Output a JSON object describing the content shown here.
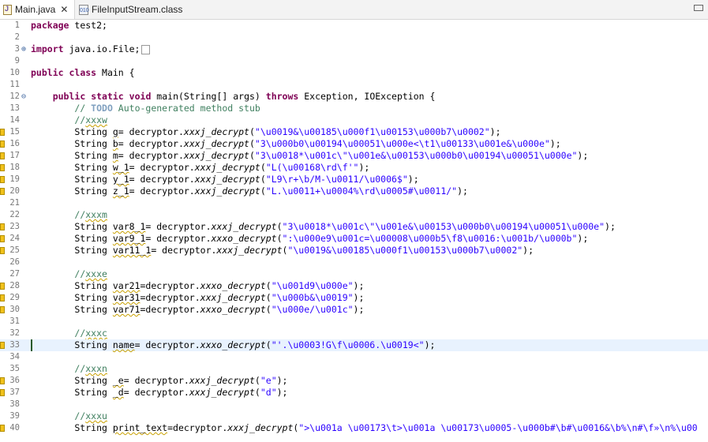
{
  "tabs": [
    {
      "label": "Main.java",
      "icon": "java-file-icon",
      "active": true
    },
    {
      "label": "FileInputStream.class",
      "icon": "class-file-icon",
      "active": false
    }
  ],
  "lines": [
    {
      "n": "1",
      "text": "package test2;"
    },
    {
      "n": "2",
      "text": ""
    },
    {
      "n": "3",
      "text": "import java.io.File;"
    },
    {
      "n": "9",
      "text": ""
    },
    {
      "n": "10",
      "text": "public class Main {"
    },
    {
      "n": "11",
      "text": ""
    },
    {
      "n": "12",
      "text": "    public static void main(String[] args) throws Exception, IOException {"
    },
    {
      "n": "13",
      "text": "        // TODO Auto-generated method stub"
    },
    {
      "n": "14",
      "text": "        //xxxw"
    },
    {
      "n": "15",
      "text": "        String g= decryptor.xxxj_decrypt(\"\\u0019&\\u00185\\u000f1\\u00153\\u000b7\\u0002\");"
    },
    {
      "n": "16",
      "text": "        String b= decryptor.xxxj_decrypt(\"3\\u000b0\\u00194\\u00051\\u000e<\\t1\\u00133\\u001e&\\u000e\");"
    },
    {
      "n": "17",
      "text": "        String m= decryptor.xxxj_decrypt(\"3\\u0018*\\u001c\\\"\\u001e&\\u00153\\u000b0\\u00194\\u00051\\u000e\");"
    },
    {
      "n": "18",
      "text": "        String w_1= decryptor.xxxj_decrypt(\"L(\\u00168\\rd\\f'\");"
    },
    {
      "n": "19",
      "text": "        String y_1= decryptor.xxxj_decrypt(\"L9\\r+\\b/M-\\u0011/\\u0006$\");"
    },
    {
      "n": "20",
      "text": "        String z_1= decryptor.xxxj_decrypt(\"L.\\u0011+\\u0004%\\rd\\u0005#\\u0011/\");"
    },
    {
      "n": "21",
      "text": ""
    },
    {
      "n": "22",
      "text": "        //xxxm"
    },
    {
      "n": "23",
      "text": "        String var8_1= decryptor.xxxj_decrypt(\"3\\u0018*\\u001c\\\"\\u001e&\\u00153\\u000b0\\u00194\\u00051\\u000e\");"
    },
    {
      "n": "24",
      "text": "        String var9_1= decryptor.xxxo_decrypt(\":\\u000e9\\u001c=\\u00008\\u000b5\\f8\\u0016:\\u001b/\\u000b\");"
    },
    {
      "n": "25",
      "text": "        String var11_1= decryptor.xxxj_decrypt(\"\\u0019&\\u00185\\u000f1\\u00153\\u000b7\\u0002\");"
    },
    {
      "n": "26",
      "text": ""
    },
    {
      "n": "27",
      "text": "        //xxxe"
    },
    {
      "n": "28",
      "text": "        String var21=decryptor.xxxo_decrypt(\"\\u001d9\\u000e\");"
    },
    {
      "n": "29",
      "text": "        String var31=decryptor.xxxj_decrypt(\"\\u000b&\\u0019\");"
    },
    {
      "n": "30",
      "text": "        String var71=decryptor.xxxo_decrypt(\"\\u000e/\\u001c\");"
    },
    {
      "n": "31",
      "text": ""
    },
    {
      "n": "32",
      "text": "        //xxxc"
    },
    {
      "n": "33",
      "text": "        String name= decryptor.xxxo_decrypt(\"'.\\u0003!G\\f\\u0006.\\u0019<\");"
    },
    {
      "n": "34",
      "text": ""
    },
    {
      "n": "35",
      "text": "        //xxxn"
    },
    {
      "n": "36",
      "text": "        String _e= decryptor.xxxj_decrypt(\"e\");"
    },
    {
      "n": "37",
      "text": "        String _d= decryptor.xxxj_decrypt(\"d\");"
    },
    {
      "n": "38",
      "text": ""
    },
    {
      "n": "39",
      "text": "        //xxxu"
    },
    {
      "n": "40",
      "text": "        String print_text=decryptor.xxxj_decrypt(\">\\u001a \\u00173\\t>\\u001a \\u00173\\u0005-\\u000b#\\b#\\u0016&\\b%\\n#\\f»\\n%\\u00"
    }
  ]
}
